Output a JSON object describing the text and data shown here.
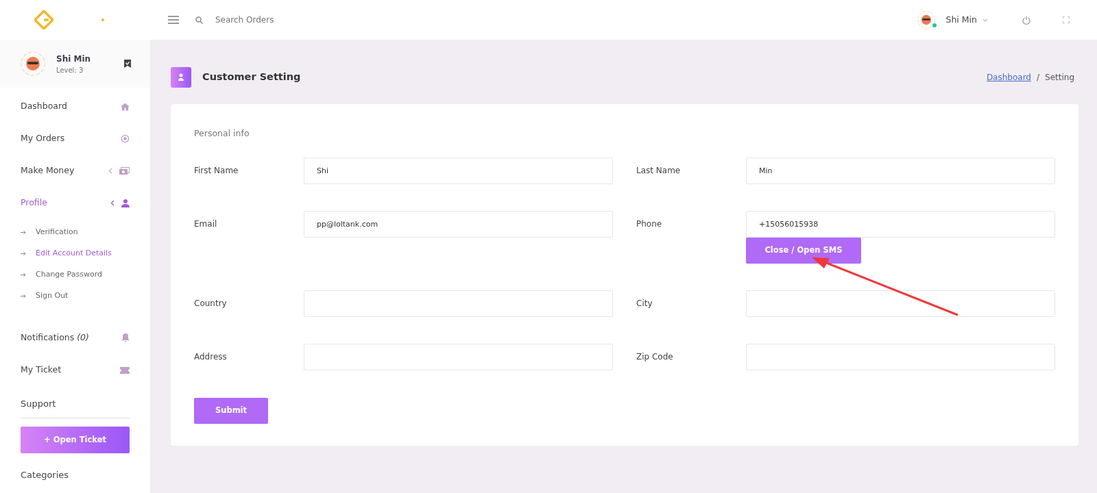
{
  "topbar": {
    "search": {
      "placeholder": "Search Orders"
    },
    "user": {
      "name": "Shi Min",
      "online": true
    }
  },
  "sidebar": {
    "user": {
      "name": "Shi Min",
      "level": "Level: 3"
    },
    "items": [
      {
        "label": "Dashboard",
        "kind": "link",
        "selected": false
      },
      {
        "label": "My Orders",
        "kind": "link",
        "selected": false
      },
      {
        "label": "Make Money",
        "kind": "menu",
        "selected": false,
        "expanded": false
      },
      {
        "label": "Profile",
        "kind": "menu",
        "selected": true,
        "expanded": true,
        "children": [
          {
            "label": "Verification",
            "selected": false
          },
          {
            "label": "Edit Account Details",
            "selected": true
          },
          {
            "label": "Change Password",
            "selected": false
          },
          {
            "label": "Sign Out",
            "selected": false
          }
        ]
      },
      {
        "label": "Notifications *(0)*",
        "kind": "link",
        "selected": false
      },
      {
        "label": "My Ticket",
        "kind": "link",
        "selected": false
      },
      {
        "label": "Support",
        "kind": "heading"
      },
      {
        "label": "+ Open Ticket",
        "kind": "button"
      },
      {
        "label": "Categories",
        "kind": "heading"
      }
    ]
  },
  "page": {
    "title": "Customer Setting",
    "breadcrumb": [
      {
        "label": "Dashboard",
        "link": true
      },
      {
        "label": "Setting",
        "link": false
      }
    ],
    "breadcrumb_separator": "/"
  },
  "form": {
    "section": "Personal info",
    "fields": [
      {
        "label": "First Name",
        "value": "Shi"
      },
      {
        "label": "Last Name",
        "value": "Min"
      },
      {
        "label": "Email",
        "value": "pp@loltank.com"
      },
      {
        "label": "Phone",
        "value": "+15056015938",
        "action": "Close / Open SMS"
      },
      {
        "label": "Country"
      },
      {
        "label": "City"
      },
      {
        "label": "Address"
      },
      {
        "label": "Zip Code"
      }
    ],
    "submit": "Submit"
  }
}
